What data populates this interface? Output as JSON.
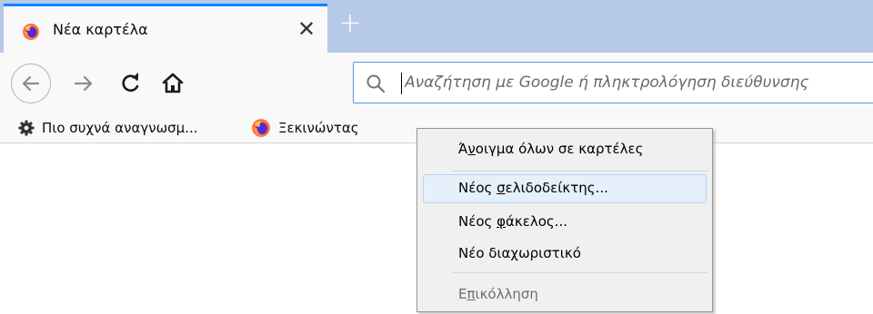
{
  "tab": {
    "title": "Νέα καρτέλα",
    "close_glyph": "✕",
    "favicon": "firefox-icon"
  },
  "newtab": {
    "glyph": "+"
  },
  "nav": {
    "back_icon": "arrow-left-icon",
    "forward_icon": "arrow-right-icon",
    "reload_icon": "reload-icon",
    "home_icon": "home-icon"
  },
  "urlbar": {
    "placeholder": "Αναζήτηση με Google ή πληκτρολόγηση διεύθυνσης",
    "value": "",
    "icon": "search-icon"
  },
  "bookmarks": {
    "items": [
      {
        "label": "Πιο συχνά αναγνωσμ...",
        "icon": "gear-icon"
      },
      {
        "label": "Ξεκινώντας",
        "icon": "firefox-icon"
      }
    ]
  },
  "context_menu": {
    "items": [
      {
        "pre": "Ά",
        "key": "ν",
        "post": "οιγμα όλων σε καρτέλες",
        "disabled": false
      },
      {
        "pre": "Νέος ",
        "key": "σ",
        "post": "ελιδοδείκτης...",
        "disabled": false,
        "hover": true
      },
      {
        "pre": "Νέος ",
        "key": "φ",
        "post": "άκελος...",
        "disabled": false
      },
      {
        "pre": "Νέο διαχωριστικό",
        "key": "",
        "post": "",
        "disabled": false
      },
      {
        "pre": "Ε",
        "key": "π",
        "post": "ικόλληση",
        "disabled": true
      }
    ]
  },
  "colors": {
    "tabstrip": "#b7c9e8",
    "accent": "#0a84ff",
    "menu_hover": "#e5f0fb"
  }
}
